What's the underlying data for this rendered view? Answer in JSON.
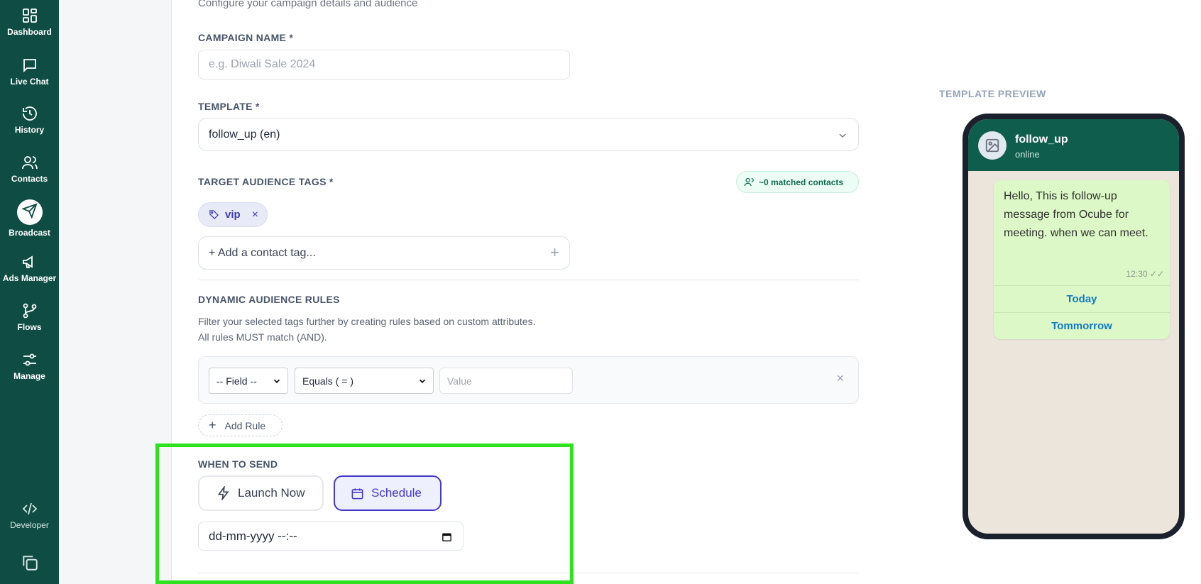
{
  "sidebar": {
    "items": [
      {
        "label": "Dashboard",
        "icon": "dashboard-icon"
      },
      {
        "label": "Live Chat",
        "icon": "chat-icon"
      },
      {
        "label": "History",
        "icon": "history-icon"
      },
      {
        "label": "Contacts",
        "icon": "contacts-icon"
      },
      {
        "label": "Broadcast",
        "icon": "send-icon"
      },
      {
        "label": "Ads Manager",
        "icon": "megaphone-icon"
      },
      {
        "label": "Flows",
        "icon": "flows-icon"
      },
      {
        "label": "Manage",
        "icon": "sliders-icon"
      }
    ],
    "developer": "Developer",
    "active": "Broadcast",
    "color": "#0f4d44"
  },
  "form": {
    "subtitle": "Configure your campaign details and audience",
    "campaign_name": {
      "label": "CAMPAIGN NAME *",
      "placeholder": "e.g. Diwali Sale 2024",
      "value": ""
    },
    "template": {
      "label": "TEMPLATE *",
      "value": "follow_up (en)"
    },
    "audience": {
      "label": "TARGET AUDIENCE TAGS *",
      "matched": "~0 matched contacts",
      "tags": [
        "vip"
      ],
      "add_placeholder": "+ Add a contact tag..."
    },
    "rules": {
      "label": "DYNAMIC AUDIENCE RULES",
      "hint_line1": "Filter your selected tags further by creating rules based on custom attributes.",
      "hint_line2": "All rules MUST match (AND).",
      "field": "-- Field --",
      "operator": "Equals ( = )",
      "value_placeholder": "Value",
      "add_rule": "Add Rule"
    },
    "when": {
      "label": "WHEN TO SEND",
      "launch_now": "Launch Now",
      "schedule": "Schedule",
      "selected": "Schedule",
      "datetime_placeholder": "dd-mm-yyyy --:--"
    }
  },
  "preview": {
    "label": "TEMPLATE PREVIEW",
    "contact": "follow_up",
    "status": "online",
    "message": "Hello, This is follow-up message from Ocube for meeting. when we can meet.",
    "time": "12:30 ✓✓",
    "quick_replies": [
      "Today",
      "Tommorrow"
    ]
  },
  "colors": {
    "accent": "#4338ca",
    "highlight": "#2ee31e",
    "whatsapp_header": "#0f5e4d"
  }
}
